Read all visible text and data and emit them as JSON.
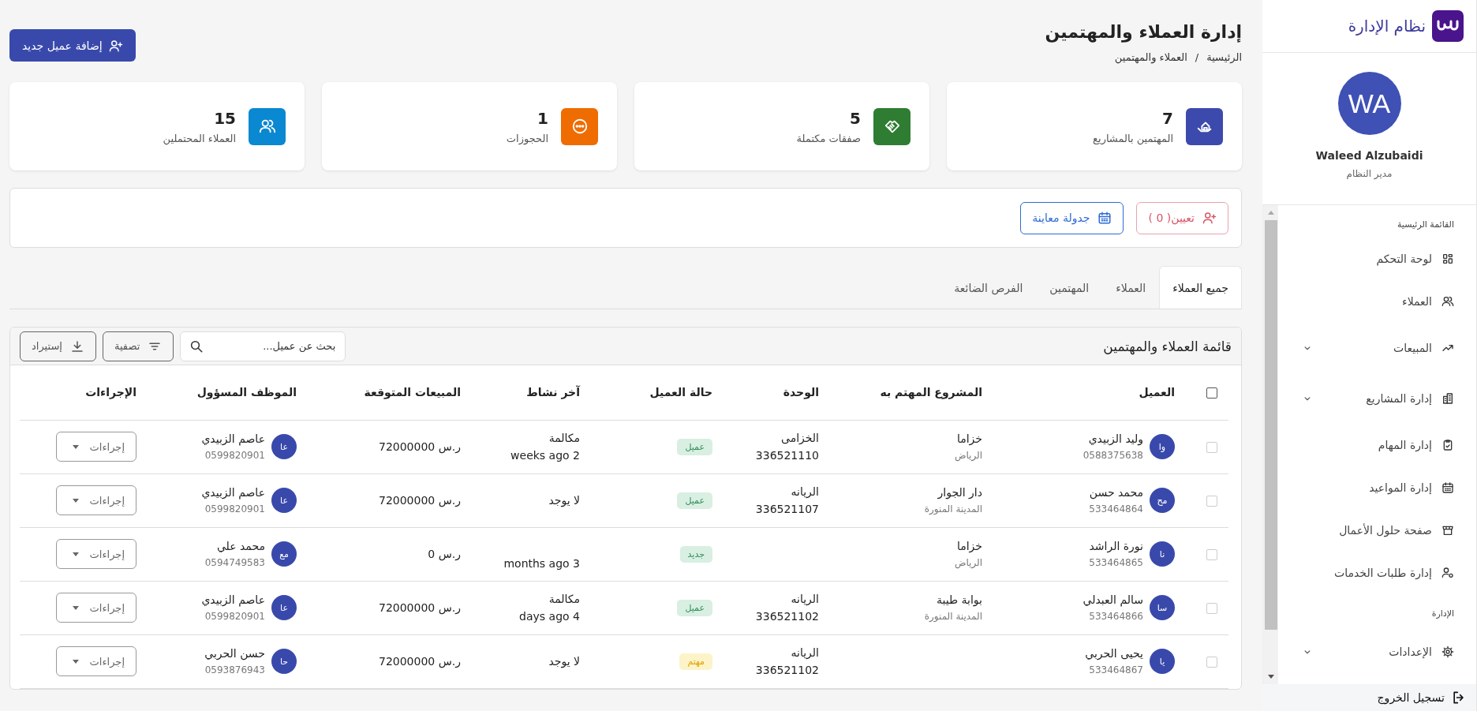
{
  "sidebar": {
    "brand": "نظام الإدارة",
    "user": {
      "initials": "WA",
      "name": "Waleed Alzubaidi",
      "role": "مدير النظام"
    },
    "sections": [
      {
        "title": "القائمة الرئيسية",
        "items": [
          {
            "label": "لوحة التحكم",
            "has_submenu": false
          },
          {
            "label": "العملاء",
            "has_submenu": false
          },
          {
            "label": "المبيعات",
            "has_submenu": true
          },
          {
            "label": "إدارة المشاريع",
            "has_submenu": true
          },
          {
            "label": "إدارة المهام",
            "has_submenu": false
          },
          {
            "label": "إدارة المواعيد",
            "has_submenu": false
          },
          {
            "label": "صفحة حلول الأعمال",
            "has_submenu": false
          },
          {
            "label": "إدارة طلبات الخدمات",
            "has_submenu": false
          }
        ]
      },
      {
        "title": "الإدارة",
        "items": [
          {
            "label": "الإعدادات",
            "has_submenu": true
          }
        ]
      }
    ],
    "logout": "تسجيل الخروج"
  },
  "header": {
    "title": "إدارة العملاء والمهتمين",
    "breadcrumb": {
      "items": [
        "الرئيسية",
        "العملاء والمهتمين"
      ],
      "separator": "/"
    },
    "add_button": "إضافة عميل جديد"
  },
  "stats": [
    {
      "value": "7",
      "label": "المهتمين بالمشاريع",
      "color": "#3d4aad"
    },
    {
      "value": "5",
      "label": "صفقات مكتملة",
      "color": "#2e7d32"
    },
    {
      "value": "1",
      "label": "الحجوزات",
      "color": "#ef6c00"
    },
    {
      "value": "15",
      "label": "العملاء المحتملين",
      "color": "#0a88d1"
    }
  ],
  "actions": {
    "assign_button": "تعيين( 0 )",
    "schedule_button": "جدولة معاينة"
  },
  "tabs": [
    {
      "label": "جميع العملاء",
      "selected": true
    },
    {
      "label": "العملاء",
      "selected": false
    },
    {
      "label": "المهتمين",
      "selected": false
    },
    {
      "label": "الفرص الضائعة",
      "selected": false
    }
  ],
  "list": {
    "title": "قائمة العملاء والمهتمين",
    "search": {
      "placeholder": "بحث عن عميل..."
    },
    "filter_button": "تصفية",
    "import_button": "إستيراد"
  },
  "table": {
    "all_checked": false,
    "columns": [
      "العميل",
      "المشروع المهتم به",
      "الوحدة",
      "حالة العميل",
      "آخر نشاط",
      "المبيعات المتوقعة",
      "الموظف المسؤول",
      "الإجراءات"
    ],
    "rows": [
      {
        "checked": false,
        "initials": "وا",
        "name": "وليد الزبيدي",
        "phone": "0588375638",
        "project": "خزاما",
        "city": "الرياض",
        "unit": "الخزامى",
        "unit_number": "336521110",
        "status": "عميل",
        "kind": "client",
        "activity_type": "مكالمة",
        "activity_time": "weeks ago 2",
        "expected_sales": "ر.س 72000000",
        "employee": {
          "initials": "عا",
          "name": "عاصم الزبيدي",
          "phone": "0599820901"
        },
        "actions": "إجراءات"
      },
      {
        "checked": false,
        "initials": "مح",
        "name": "محمد حسن",
        "phone": "533464864",
        "project": "دار الجوار",
        "city": "المدينة المنورة",
        "unit": "الريانه",
        "unit_number": "336521107",
        "status": "عميل",
        "kind": "client",
        "activity_type": "لا يوجد",
        "expected_sales": "ر.س 72000000",
        "employee": {
          "initials": "عا",
          "name": "عاصم الزبيدي",
          "phone": "0599820901"
        },
        "actions": "إجراءات"
      },
      {
        "checked": false,
        "initials": "نا",
        "name": "نورة الراشد",
        "phone": "533464865",
        "project": "خزاما",
        "city": "الرياض",
        "status": "جديد",
        "kind": "new",
        "activity_time": "months ago 3",
        "expected_sales": "ر.س 0",
        "employee": {
          "initials": "مع",
          "name": "محمد علي",
          "phone": "0594749583"
        },
        "actions": "إجراءات"
      },
      {
        "checked": false,
        "initials": "سا",
        "name": "سالم العبدلي",
        "phone": "533464866",
        "project": "بوابة طيبة",
        "city": "المدينة المنورة",
        "unit": "الريانه",
        "unit_number": "336521102",
        "status": "عميل",
        "kind": "client",
        "activity_type": "مكالمة",
        "activity_time": "days ago 4",
        "expected_sales": "ر.س 72000000",
        "employee": {
          "initials": "عا",
          "name": "عاصم الزبيدي",
          "phone": "0599820901"
        },
        "actions": "إجراءات"
      },
      {
        "checked": false,
        "initials": "يا",
        "name": "يحيى الحربي",
        "phone": "533464867",
        "unit": "الريانه",
        "unit_number": "336521102",
        "status": "مهتم",
        "kind": "interested",
        "activity_type": "لا يوجد",
        "expected_sales": "ر.س 72000000",
        "employee": {
          "initials": "حا",
          "name": "حسن الحربي",
          "phone": "0593876943"
        },
        "actions": "إجراءات"
      }
    ]
  }
}
